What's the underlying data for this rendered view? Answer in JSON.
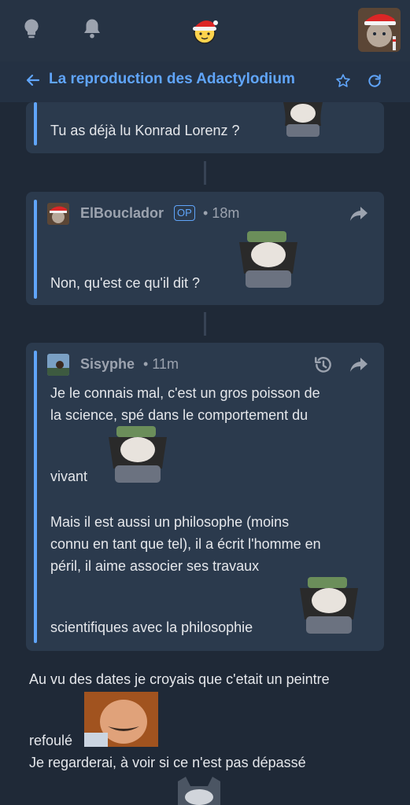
{
  "header": {
    "title": "La reproduction des Adactylodium"
  },
  "thread": {
    "comment1": {
      "text": "Tu as déjà lu Konrad Lorenz ?"
    },
    "comment2": {
      "author": "ElBouclador",
      "op_badge": "OP",
      "time": "• 18m",
      "text": "Non, qu'est ce qu'il dit ?"
    },
    "comment3": {
      "author": "Sisyphe",
      "time": "• 11m",
      "lines": [
        "Je le connais mal, c'est un gros poisson de",
        "la science, spé dans le comportement du",
        "vivant",
        "Mais il est aussi un philosophe (moins",
        "connu en tant que tel), il a écrit l'homme en",
        "péril, il aime associer ses travaux",
        "scientifiques avec la philosophie"
      ]
    },
    "comment4": {
      "lines": [
        "Au vu des dates je croyais que c'etait un peintre",
        "refoulé",
        "Je regarderai, à voir si ce n'est pas dépassé"
      ]
    }
  },
  "colors": {
    "accent": "#60a5fa",
    "background": "#1f2937",
    "card": "#2b3a4d"
  },
  "icons": [
    "lightbulb-icon",
    "bell-icon",
    "mascot-santa-icon",
    "back-arrow-icon",
    "star-icon",
    "refresh-icon",
    "share-icon",
    "history-icon"
  ]
}
